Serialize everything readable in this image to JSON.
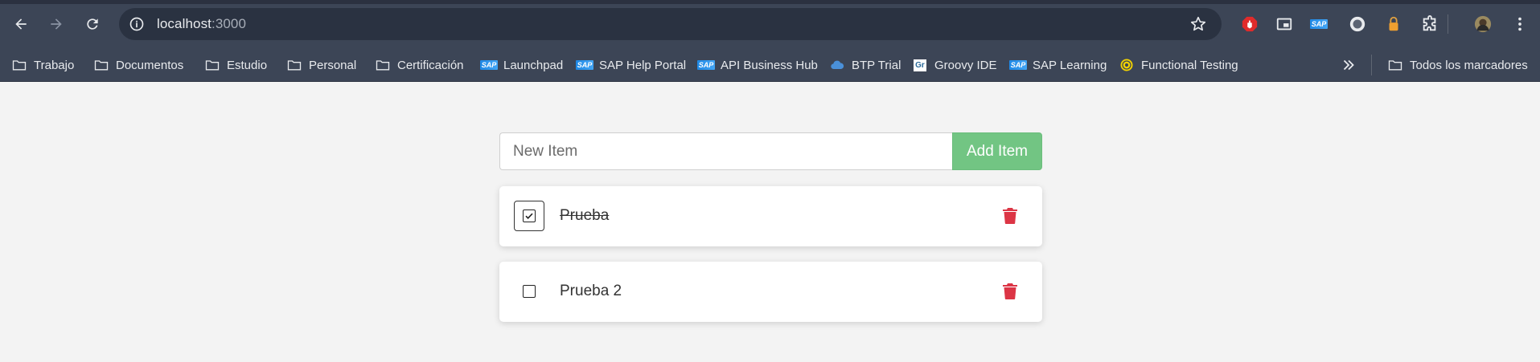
{
  "browser": {
    "url_host": "localhost",
    "url_port": ":3000",
    "nav": {
      "back": "back-arrow-icon",
      "forward": "forward-arrow-icon",
      "reload": "reload-icon"
    },
    "extensions": [
      "adblock-icon",
      "picture-in-picture-icon",
      "sap-icon",
      "extension-avatar-icon",
      "password-lock-icon",
      "extensions-puzzle-icon",
      "profile-avatar-icon",
      "menu-kebab-icon"
    ]
  },
  "bookmarks": [
    {
      "label": "Trabajo",
      "icon": "folder-icon"
    },
    {
      "label": "Documentos",
      "icon": "folder-icon"
    },
    {
      "label": "Estudio",
      "icon": "folder-icon"
    },
    {
      "label": "Personal",
      "icon": "folder-icon"
    },
    {
      "label": "Certificación",
      "icon": "folder-icon"
    },
    {
      "label": "Launchpad",
      "icon": "sap-logo-icon"
    },
    {
      "label": "SAP Help Portal",
      "icon": "sap-logo-icon"
    },
    {
      "label": "API Business Hub",
      "icon": "sap-logo-icon"
    },
    {
      "label": "BTP Trial",
      "icon": "cloud-icon"
    },
    {
      "label": "Groovy IDE",
      "icon": "groovy-icon"
    },
    {
      "label": "SAP Learning",
      "icon": "sap-logo-icon"
    },
    {
      "label": "Functional Testing",
      "icon": "target-icon"
    }
  ],
  "bookmarks_all": {
    "label": "Todos los marcadores",
    "icon": "folder-icon"
  },
  "sap_badge": "SAP",
  "groovy_badge": "Gr",
  "form": {
    "placeholder": "New Item",
    "value": "",
    "add_label": "Add Item"
  },
  "todos": [
    {
      "text": "Prueba",
      "completed": true
    },
    {
      "text": "Prueba 2",
      "completed": false
    }
  ],
  "colors": {
    "add_button": "#72c583",
    "delete": "#dc3545",
    "chrome": "#3c4556"
  }
}
